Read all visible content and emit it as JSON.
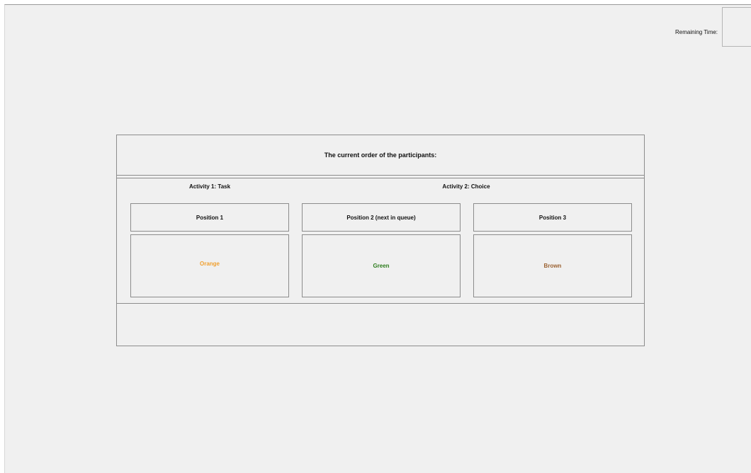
{
  "timer": {
    "label": "Remaining Time:",
    "value": ""
  },
  "panel": {
    "title": "The current order of the participants:",
    "activities": [
      {
        "label": "Activity 1: Task"
      },
      {
        "label": "Activity 2: Choice"
      }
    ],
    "positions": [
      {
        "header": "Position 1",
        "participant": "Orange",
        "color": "#f0a030"
      },
      {
        "header": "Position 2 (next in queue)",
        "participant": "Green",
        "color": "#2e7d1e"
      },
      {
        "header": "Position 3",
        "participant": "Brown",
        "color": "#9b6232"
      }
    ]
  }
}
